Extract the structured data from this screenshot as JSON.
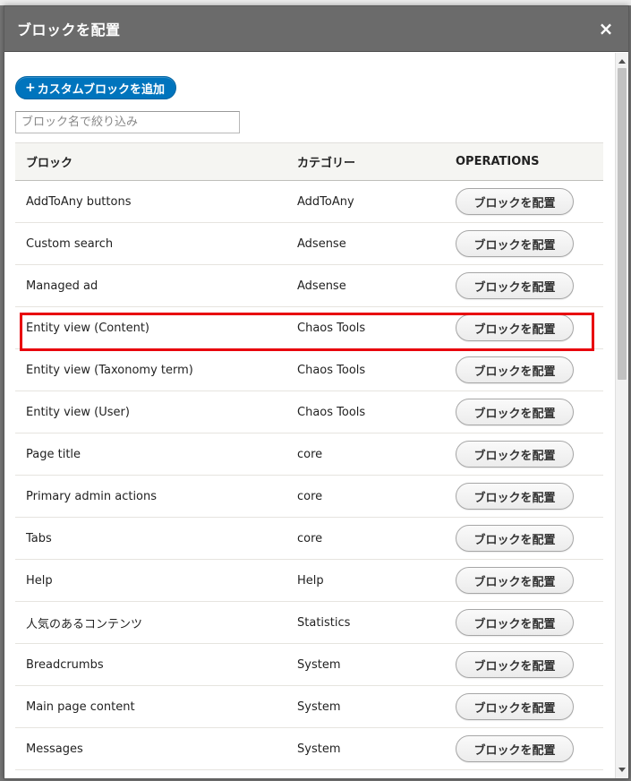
{
  "dialog": {
    "title": "ブロックを配置",
    "close_label": "×"
  },
  "add_button": {
    "plus": "+",
    "label": "カスタムブロックを追加"
  },
  "filter": {
    "placeholder": "ブロック名で絞り込み"
  },
  "table": {
    "headers": [
      "ブロック",
      "カテゴリー",
      "OPERATIONS"
    ],
    "button_label": "ブロックを配置",
    "rows": [
      {
        "block": "AddToAny buttons",
        "category": "AddToAny"
      },
      {
        "block": "Custom search",
        "category": "Adsense"
      },
      {
        "block": "Managed ad",
        "category": "Adsense"
      },
      {
        "block": "Entity view (Content)",
        "category": "Chaos Tools"
      },
      {
        "block": "Entity view (Taxonomy term)",
        "category": "Chaos Tools"
      },
      {
        "block": "Entity view (User)",
        "category": "Chaos Tools"
      },
      {
        "block": "Page title",
        "category": "core"
      },
      {
        "block": "Primary admin actions",
        "category": "core"
      },
      {
        "block": "Tabs",
        "category": "core"
      },
      {
        "block": "Help",
        "category": "Help"
      },
      {
        "block": "人気のあるコンテンツ",
        "category": "Statistics"
      },
      {
        "block": "Breadcrumbs",
        "category": "System"
      },
      {
        "block": "Main page content",
        "category": "System"
      },
      {
        "block": "Messages",
        "category": "System"
      }
    ]
  },
  "colors": {
    "title_bar": "#6b6b6b",
    "primary_button": "#0074bd",
    "highlight": "#e8000c"
  }
}
